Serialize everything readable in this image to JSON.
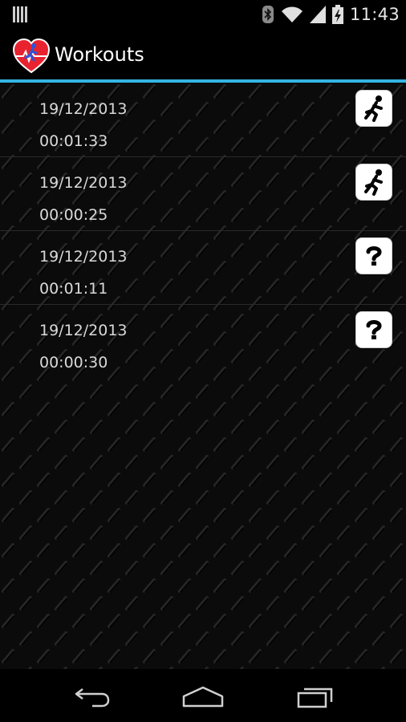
{
  "status_bar": {
    "time": "11:43",
    "icons": [
      "notification-bars-icon",
      "bluetooth-icon",
      "wifi-icon",
      "signal-icon",
      "battery-charging-icon"
    ]
  },
  "action_bar": {
    "title": "Workouts",
    "icon": "heart-runner-app-icon"
  },
  "colors": {
    "accent": "#33b5e5",
    "heart": "#e8232f"
  },
  "workouts": [
    {
      "date": "19/12/2013",
      "duration": "00:01:33",
      "type_icon": "running-icon"
    },
    {
      "date": "19/12/2013",
      "duration": "00:00:25",
      "type_icon": "running-icon"
    },
    {
      "date": "19/12/2013",
      "duration": "00:01:11",
      "type_icon": "question-mark-icon"
    },
    {
      "date": "19/12/2013",
      "duration": "00:00:30",
      "type_icon": "question-mark-icon"
    }
  ],
  "nav_bar": {
    "buttons": [
      "back-icon",
      "home-icon",
      "recent-apps-icon"
    ]
  }
}
